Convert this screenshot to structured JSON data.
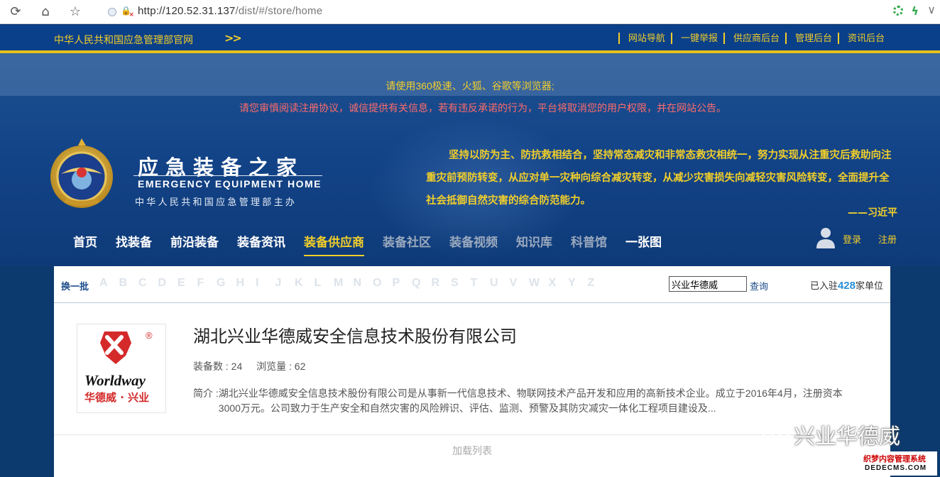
{
  "browser": {
    "url_host": "http://120.52.31.137",
    "url_path": "/dist/#/store/home"
  },
  "topbar": {
    "ministry_link": "中华人民共和国应急管理部官网",
    "links": [
      "网站导航",
      "一键举报",
      "供应商后台",
      "管理后台",
      "资讯后台"
    ]
  },
  "notices": {
    "browser_tip": "请使用360极速、火狐、谷歌等浏览器;",
    "agreement_tip": "请您审慎阅读注册协议，诚信提供有关信息，若有违反承诺的行为，平台将取消您的用户权限，并在网站公告。"
  },
  "brand": {
    "name_cn": "应急装备之家",
    "name_en": "EMERGENCY EQUIPMENT HOME",
    "sponsor": "中华人民共和国应急管理部主办"
  },
  "quote": {
    "text": "坚持以防为主、防抗救相结合，坚持常态减灾和非常态救灾相统一，努力实现从注重灾后救助向注重灾前预防转变，从应对单一灾种向综合减灾转变，从减少灾害损失向减轻灾害风险转变，全面提升全社会抵御自然灾害的综合防范能力。",
    "author": "——习近平"
  },
  "nav": {
    "items": [
      {
        "label": "首页"
      },
      {
        "label": "找装备"
      },
      {
        "label": "前沿装备"
      },
      {
        "label": "装备资讯"
      },
      {
        "label": "装备供应商"
      },
      {
        "label": "装备社区"
      },
      {
        "label": "装备视频"
      },
      {
        "label": "知识库"
      },
      {
        "label": "科普馆"
      },
      {
        "label": "一张图"
      }
    ],
    "login": "登录",
    "register": "注册"
  },
  "filter": {
    "refresh_label": "换一批",
    "letters": [
      "A",
      "B",
      "C",
      "D",
      "E",
      "F",
      "G",
      "H",
      "I",
      "J",
      "K",
      "L",
      "M",
      "N",
      "O",
      "P",
      "Q",
      "R",
      "S",
      "T",
      "U",
      "V",
      "W",
      "X",
      "Y",
      "Z"
    ],
    "search_value": "兴业华德威",
    "search_button": "查询",
    "count_prefix": "已入驻",
    "count_value": "428",
    "count_suffix": "家单位"
  },
  "company": {
    "name": "湖北兴业华德威安全信息技术股份有限公司",
    "logo_text_en": "Worldway",
    "logo_text_cn": "华德威 · 兴业",
    "logo_reg": "®",
    "equipment_count_label": "装备数 : 24",
    "views_label": "浏览量 : 62",
    "intro_label": "简介 :",
    "intro_text": "湖北兴业华德威安全信息技术股份有限公司是从事新一代信息技术、物联网技术产品开发和应用的高新技术企业。成立于2016年4月，注册资本3000万元。公司致力于生产安全和自然灾害的风险辨识、评估、监测、预警及其防灾减灾一体化工程项目建设及..."
  },
  "load_more": "加载列表",
  "watermarks": {
    "wechat_text": "兴业华德威",
    "dede_cn": "织梦内容管理系统",
    "dede_en": "DEDECMS.COM"
  },
  "colors": {
    "accent_yellow": "#f2cf2a",
    "nav_blue": "#0a3f8a",
    "warning_red": "#ff6b6b",
    "count_blue": "#2a8fd8"
  }
}
